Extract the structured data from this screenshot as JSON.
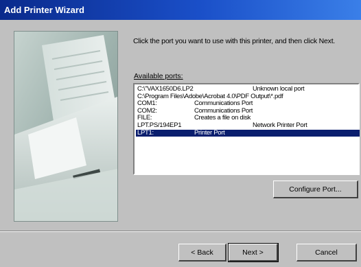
{
  "window": {
    "title": "Add Printer Wizard"
  },
  "instructions": "Click the port you want to use with this printer, and then click Next.",
  "ports_label": "Available ports:",
  "ports": [
    {
      "port": "C:\\\"VAX1650D6.LP2",
      "description": "Unknown local port"
    },
    {
      "port": "C:\\Program Files\\Adobe\\Acrobat 4.0\\PDF Output\\*.pdf",
      "description": ""
    },
    {
      "port": "COM1:",
      "description": "Communications Port"
    },
    {
      "port": "COM2:",
      "description": "Communications Port"
    },
    {
      "port": "FILE:",
      "description": "Creates a file on disk"
    },
    {
      "port": "LPT.PS/194EP1",
      "description": "Network Printer Port"
    },
    {
      "port": "LPT1:",
      "description": "Printer Port",
      "selected": true
    }
  ],
  "buttons": {
    "configure": "Configure Port...",
    "back": "< Back",
    "next": "Next >",
    "cancel": "Cancel"
  }
}
